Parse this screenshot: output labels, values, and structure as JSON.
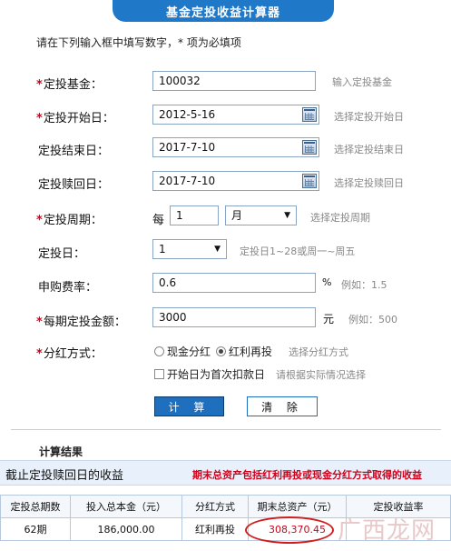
{
  "header": {
    "title": "基金定投收益计算器"
  },
  "tip": "请在下列输入框中填写数字，* 项为必填项",
  "form": {
    "fund": {
      "label": "定投基金：",
      "required": true,
      "value": "100032",
      "hint": "输入定投基金"
    },
    "start": {
      "label": "定投开始日：",
      "required": true,
      "value": "2012-5-16",
      "hint": "选择定投开始日"
    },
    "end": {
      "label": "定投结束日：",
      "required": false,
      "value": "2017-7-10",
      "hint": "选择定投结束日"
    },
    "redeem": {
      "label": "定投赎回日：",
      "required": false,
      "value": "2017-7-10",
      "hint": "选择定投赎回日"
    },
    "period": {
      "label": "定投周期：",
      "required": true,
      "prefix": "每",
      "count": "1",
      "unit": "月",
      "hint": "选择定投周期"
    },
    "day": {
      "label": "定投日：",
      "required": false,
      "value": "1",
      "hint": "定投日1~28或周一~周五"
    },
    "fee": {
      "label": "申购费率：",
      "required": false,
      "value": "0.6",
      "suffix": "%",
      "hint": "例如：1.5"
    },
    "amount": {
      "label": "每期定投金额：",
      "required": true,
      "value": "3000",
      "suffix": "元",
      "hint": "例如：500"
    },
    "dividend": {
      "label": "分红方式：",
      "required": true,
      "option_cash": "现金分红",
      "option_reinvest": "红利再投",
      "selected": "红利再投",
      "hint": "选择分红方式",
      "first_day_label": "开始日为首次扣款日",
      "first_day_hint": "请根据实际情况选择"
    },
    "buttons": {
      "calc": "计 算",
      "clear": "清 除"
    }
  },
  "results": {
    "section_title": "计算结果",
    "bar_title": "截止定投赎回日的收益",
    "bar_note": "期末总资产包括红利再投或现金分红方式取得的收益",
    "columns": [
      "定投总期数",
      "投入总本金（元）",
      "分红方式",
      "期末总资产（元）",
      "定投收益率"
    ],
    "row": [
      "62期",
      "186,000.00",
      "红利再投",
      "308,370.45",
      ""
    ]
  },
  "watermark": "广西龙网",
  "colors": {
    "accent": "#1f78c8",
    "required": "#d0021b"
  }
}
